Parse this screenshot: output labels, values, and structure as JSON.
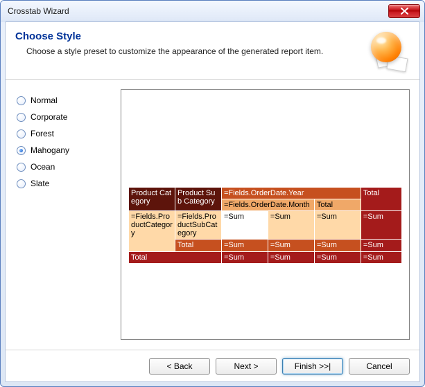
{
  "window": {
    "title": "Crosstab Wizard"
  },
  "header": {
    "title": "Choose Style",
    "subtitle": "Choose a style preset to customize the appearance of the generated report item."
  },
  "styles": {
    "items": [
      {
        "label": "Normal",
        "selected": false
      },
      {
        "label": "Corporate",
        "selected": false
      },
      {
        "label": "Forest",
        "selected": false
      },
      {
        "label": "Mahogany",
        "selected": true
      },
      {
        "label": "Ocean",
        "selected": false
      },
      {
        "label": "Slate",
        "selected": false
      }
    ]
  },
  "crosstab": {
    "row_header1": "Product Category",
    "row_header2": "Product Sub Category",
    "col_header_year": "=Fields.OrderDate.Year",
    "col_header_month": "=Fields.OrderDate.Month",
    "total_label": "Total",
    "row_field1": "=Fields.ProductCategory",
    "row_field2": "=Fields.ProductSubCategory",
    "sum_label": "=Sum"
  },
  "footer": {
    "back": "< Back",
    "next": "Next >",
    "finish": "Finish >>|",
    "cancel": "Cancel"
  }
}
